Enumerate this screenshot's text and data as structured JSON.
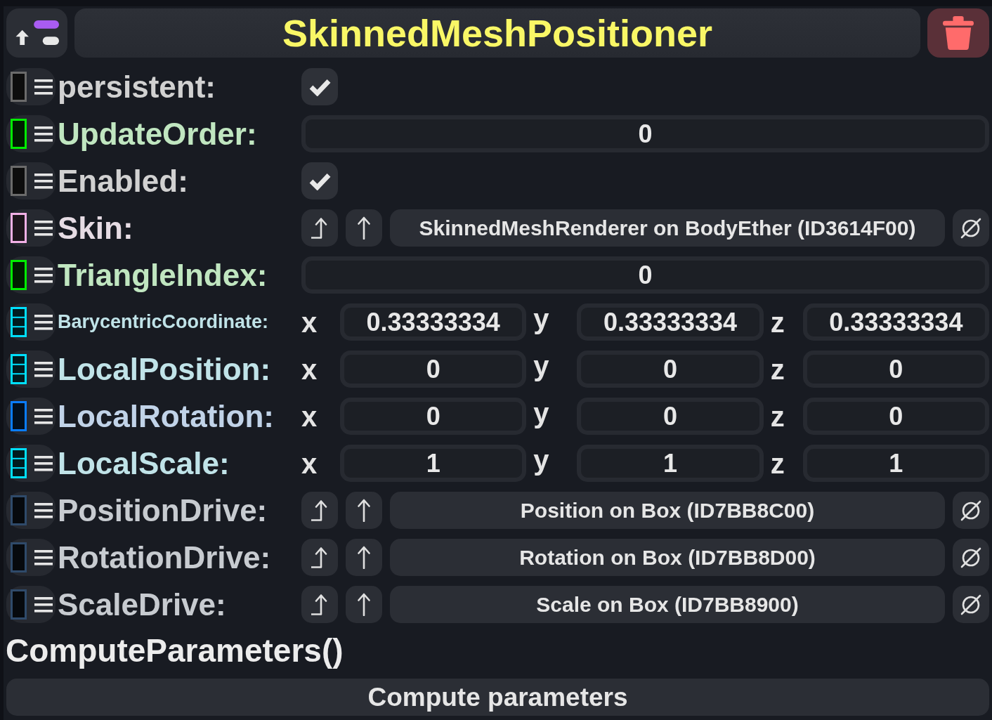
{
  "header": {
    "title": "SkinnedMeshPositioner"
  },
  "fields": [
    {
      "kind": "checkbox",
      "label": "persistent:",
      "type_mark": {
        "color": "#6b6b6b",
        "kind": "single"
      },
      "checked": true
    },
    {
      "kind": "number",
      "label": "UpdateOrder:",
      "type_mark": {
        "color": "#00ee00",
        "kind": "single"
      },
      "value": "0"
    },
    {
      "kind": "checkbox",
      "label": "Enabled:",
      "type_mark": {
        "color": "#6b6b6b",
        "kind": "single"
      },
      "checked": true
    },
    {
      "kind": "reference",
      "label": "Skin:",
      "type_mark": {
        "color": "#f2b0e6",
        "kind": "single"
      },
      "target": "SkinnedMeshRenderer on BodyEther (ID3614F00)"
    },
    {
      "kind": "number",
      "label": "TriangleIndex:",
      "type_mark": {
        "color": "#00ee00",
        "kind": "single"
      },
      "value": "0"
    },
    {
      "kind": "vector",
      "label": "BarycentricCoordinate:",
      "type_mark": {
        "color": "#00e0ff",
        "kind": "stacked"
      },
      "components": [
        {
          "axis": "x",
          "value": "0.33333334"
        },
        {
          "axis": "y",
          "value": "0.33333334"
        },
        {
          "axis": "z",
          "value": "0.33333334"
        }
      ]
    },
    {
      "kind": "vector",
      "label": "LocalPosition:",
      "type_mark": {
        "color": "#00e0ff",
        "kind": "stacked"
      },
      "components": [
        {
          "axis": "x",
          "value": "0"
        },
        {
          "axis": "y",
          "value": "0"
        },
        {
          "axis": "z",
          "value": "0"
        }
      ]
    },
    {
      "kind": "vector",
      "label": "LocalRotation:",
      "type_mark": {
        "color": "#0a7cff",
        "kind": "single"
      },
      "components": [
        {
          "axis": "x",
          "value": "0"
        },
        {
          "axis": "y",
          "value": "0"
        },
        {
          "axis": "z",
          "value": "0"
        }
      ]
    },
    {
      "kind": "vector",
      "label": "LocalScale:",
      "type_mark": {
        "color": "#00e0ff",
        "kind": "stacked"
      },
      "components": [
        {
          "axis": "x",
          "value": "1"
        },
        {
          "axis": "y",
          "value": "1"
        },
        {
          "axis": "z",
          "value": "1"
        }
      ]
    },
    {
      "kind": "reference",
      "label": "PositionDrive:",
      "type_mark": {
        "color": "#2f4a6a",
        "kind": "single"
      },
      "target": "Position on Box (ID7BB8C00)"
    },
    {
      "kind": "reference",
      "label": "RotationDrive:",
      "type_mark": {
        "color": "#2f4a6a",
        "kind": "single"
      },
      "target": "Rotation on Box (ID7BB8D00)"
    },
    {
      "kind": "reference",
      "label": "ScaleDrive:",
      "type_mark": {
        "color": "#2f4a6a",
        "kind": "single"
      },
      "target": "Scale on Box (ID7BB8900)"
    }
  ],
  "method": {
    "name": "ComputeParameters()",
    "button": "Compute parameters"
  }
}
